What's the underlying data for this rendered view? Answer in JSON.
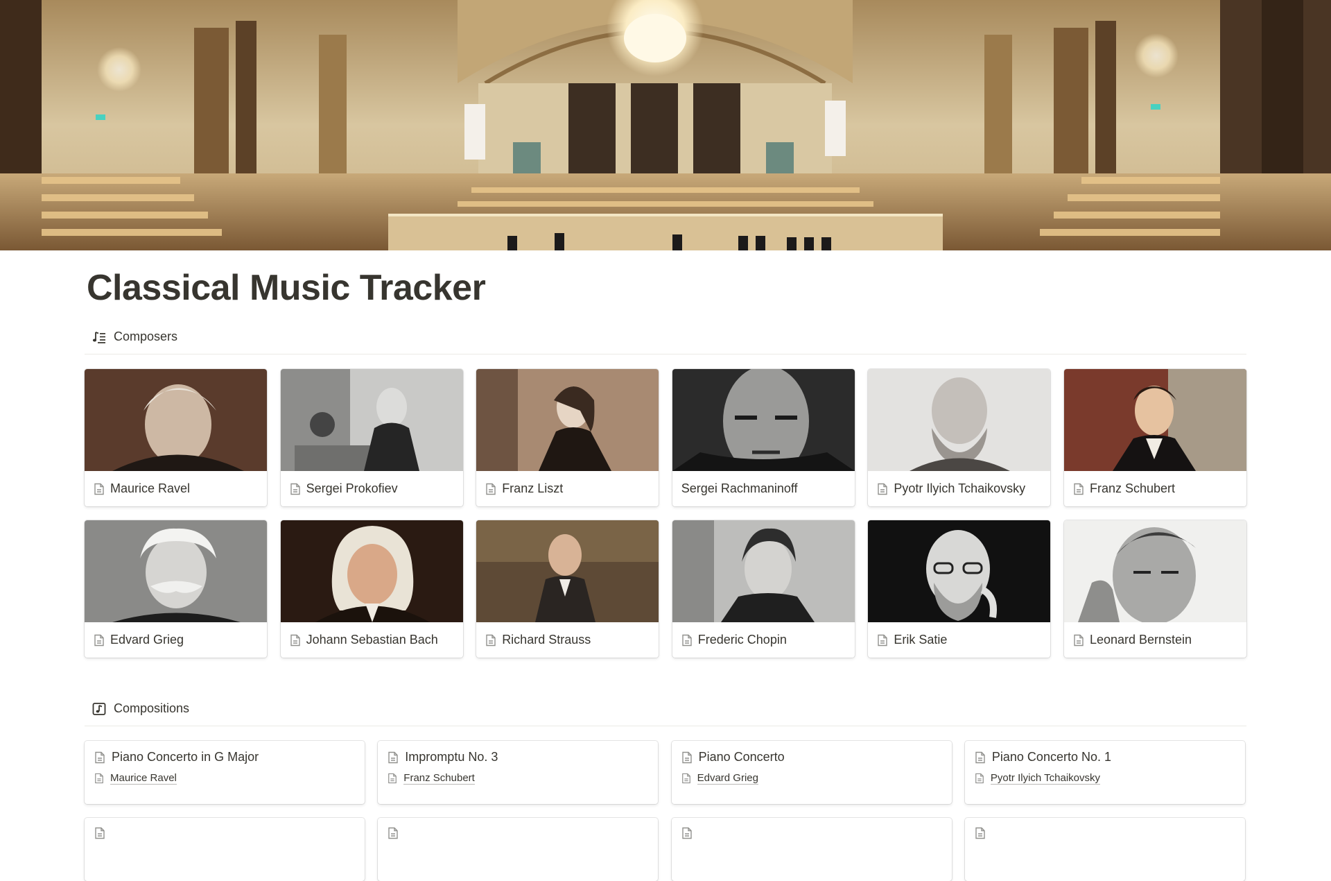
{
  "page": {
    "title": "Classical Music Tracker"
  },
  "composers": {
    "heading": "Composers",
    "icon": "music-list-icon",
    "cards": [
      {
        "name": "Maurice Ravel",
        "has_doc_icon": true,
        "photo": "sepia"
      },
      {
        "name": "Sergei Prokofiev",
        "has_doc_icon": true,
        "photo": "grey"
      },
      {
        "name": "Franz Liszt",
        "has_doc_icon": true,
        "photo": "sepia"
      },
      {
        "name": "Sergei Rachmaninoff",
        "has_doc_icon": false,
        "photo": "dark"
      },
      {
        "name": "Pyotr Ilyich Tchaikovsky",
        "has_doc_icon": true,
        "photo": "light"
      },
      {
        "name": "Franz Schubert",
        "has_doc_icon": true,
        "photo": "painting"
      },
      {
        "name": "Edvard Grieg",
        "has_doc_icon": true,
        "photo": "grey"
      },
      {
        "name": "Johann Sebastian Bach",
        "has_doc_icon": true,
        "photo": "painting-dark"
      },
      {
        "name": "Richard Strauss",
        "has_doc_icon": true,
        "photo": "painting"
      },
      {
        "name": "Frederic Chopin",
        "has_doc_icon": true,
        "photo": "grey"
      },
      {
        "name": "Erik Satie",
        "has_doc_icon": true,
        "photo": "dark"
      },
      {
        "name": "Leonard Bernstein",
        "has_doc_icon": true,
        "photo": "light"
      }
    ]
  },
  "compositions": {
    "heading": "Compositions",
    "icon": "music-note-icon",
    "cards": [
      {
        "title": "Piano Concerto in G Major",
        "composer": "Maurice Ravel"
      },
      {
        "title": "Impromptu No. 3",
        "composer": "Franz Schubert"
      },
      {
        "title": "Piano Concerto",
        "composer": "Edvard Grieg"
      },
      {
        "title": "Piano Concerto No. 1",
        "composer": "Pyotr Ilyich Tchaikovsky"
      },
      {
        "title": "",
        "composer": ""
      },
      {
        "title": "",
        "composer": ""
      },
      {
        "title": "",
        "composer": ""
      },
      {
        "title": "",
        "composer": ""
      }
    ]
  },
  "colors": {
    "text": "#37352f",
    "divider": "#ebeae6",
    "icon": "#91918e"
  }
}
